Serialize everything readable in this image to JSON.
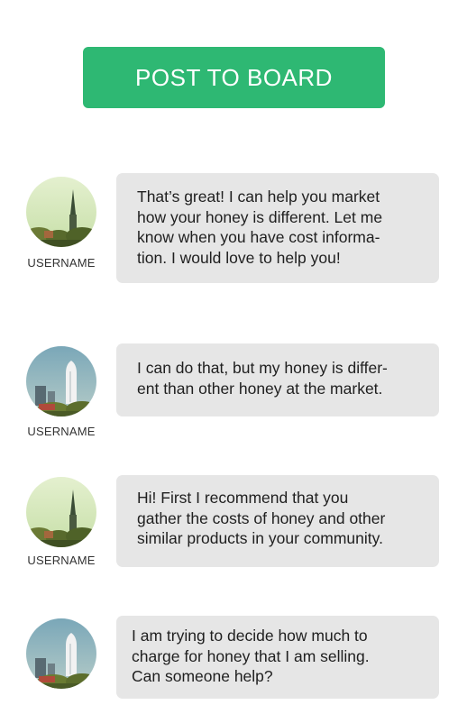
{
  "post_button": {
    "label": "POST TO BOARD"
  },
  "colors": {
    "accent": "#2eb873",
    "bubble": "#e6e6e6"
  },
  "messages": [
    {
      "username": "USERNAME",
      "avatar_icon": "church-spire-avatar-icon",
      "lines": [
        "That’s great! I can help you market",
        "how your honey is different. Let me",
        "know when you have cost informa-",
        "tion. I would love to help you!"
      ]
    },
    {
      "username": "USERNAME",
      "avatar_icon": "skyscraper-avatar-icon",
      "lines": [
        "I can do that, but my honey is differ-",
        "ent than other honey at the market."
      ]
    },
    {
      "username": "USERNAME",
      "avatar_icon": "church-spire-avatar-icon",
      "lines": [
        "Hi! First I recommend that you",
        "gather the costs of honey and other",
        "similar products in your community."
      ]
    },
    {
      "avatar_icon": "skyscraper-avatar-icon",
      "lines": [
        "I am trying to decide how much to",
        "charge for honey that I am selling.",
        "Can someone help?"
      ]
    }
  ]
}
